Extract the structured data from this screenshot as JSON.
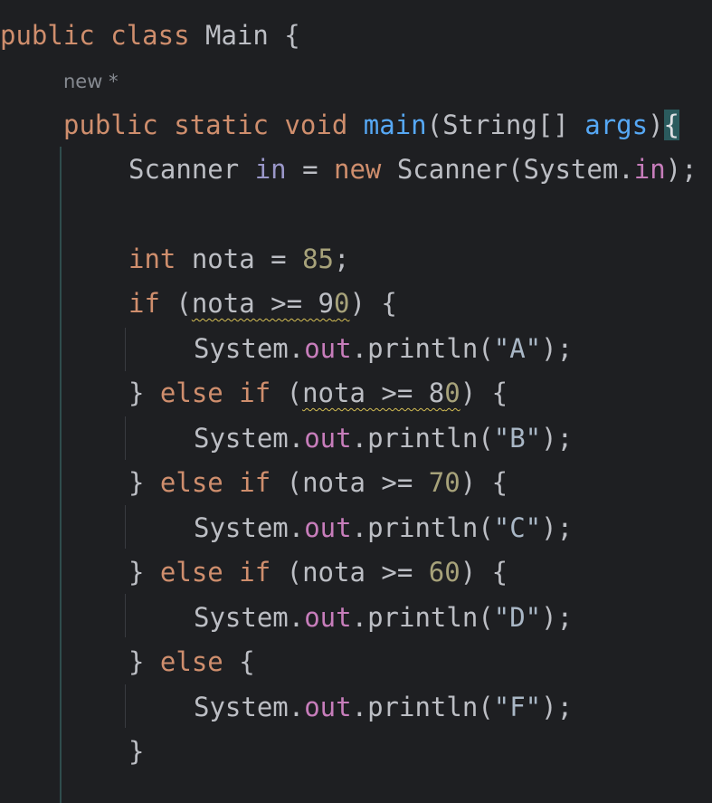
{
  "editor": {
    "language": "Java",
    "colors": {
      "background": "#1e1f22",
      "keyword": "#cf8e6d",
      "method_declaration": "#56a8f5",
      "number": "#a7a27a",
      "field": "#c77dbb",
      "string": "#a9b7c6",
      "plain": "#bcbec4",
      "warning_underline": "#d6bf55"
    },
    "code_hint": "new *",
    "lines": {
      "l1": {
        "kw_public": "public",
        "kw_class": "class",
        "name": " Main {"
      },
      "l3": {
        "kw_public": "public",
        "kw_static": "static",
        "kw_void": "void",
        "name": "main",
        "open": "(String[] ",
        "param": "args",
        "close": ")",
        "brace": "{"
      },
      "l4": {
        "type": "Scanner ",
        "var": "in",
        "eq": " = ",
        "kw_new": "new",
        "call": " Scanner(System.",
        "field": "in",
        "end": ");"
      },
      "l6": {
        "kw_int": "int",
        "rest": " nota = ",
        "num": "85",
        "end": ";"
      },
      "l7": {
        "kw_if": "if",
        "open": " (",
        "cond": "nota >= 9",
        "num": "0",
        "close": ") {"
      },
      "l8": {
        "obj": "System.",
        "field": "out",
        "call": ".println(",
        "str": "\"A\"",
        "end": ");"
      },
      "l9": {
        "brace": "} ",
        "kw_else": "else",
        "kw_if": "if",
        "open": " (",
        "cond": "nota >= 8",
        "num": "0",
        "close": ") {"
      },
      "l10": {
        "obj": "System.",
        "field": "out",
        "call": ".println(",
        "str": "\"B\"",
        "end": ");"
      },
      "l11": {
        "brace": "} ",
        "kw_else": "else",
        "kw_if": "if",
        "open": " (nota >= ",
        "num": "70",
        "close": ") {"
      },
      "l12": {
        "obj": "System.",
        "field": "out",
        "call": ".println(",
        "str": "\"C\"",
        "end": ");"
      },
      "l13": {
        "brace": "} ",
        "kw_else": "else",
        "kw_if": "if",
        "open": " (nota >= ",
        "num": "60",
        "close": ") {"
      },
      "l14": {
        "obj": "System.",
        "field": "out",
        "call": ".println(",
        "str": "\"D\"",
        "end": ");"
      },
      "l15": {
        "brace": "} ",
        "kw_else": "else",
        "close": " {"
      },
      "l16": {
        "obj": "System.",
        "field": "out",
        "call": ".println(",
        "str": "\"F\"",
        "end": ");"
      },
      "l17": {
        "brace": "}"
      }
    }
  }
}
